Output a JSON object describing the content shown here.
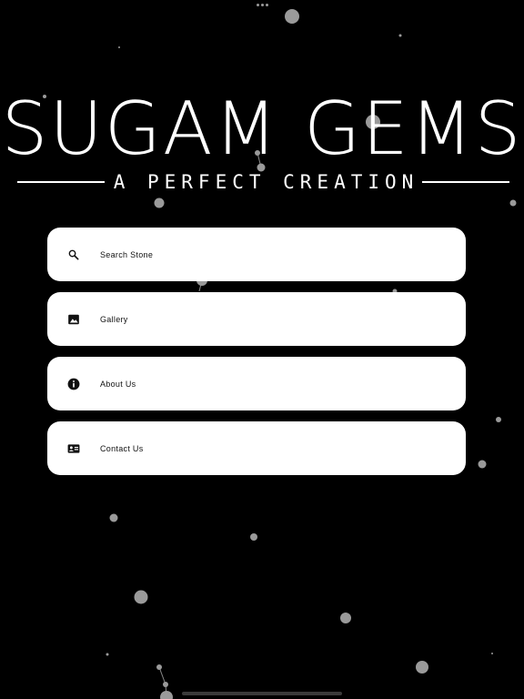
{
  "brand": {
    "title": "SUGAM GEMS",
    "tagline": "A PERFECT CREATION"
  },
  "menu": {
    "items": [
      {
        "label": "Search Stone",
        "icon": "search-icon"
      },
      {
        "label": "Gallery",
        "icon": "image-icon"
      },
      {
        "label": "About Us",
        "icon": "info-icon"
      },
      {
        "label": "Contact Us",
        "icon": "contact-card-icon"
      }
    ]
  },
  "colors": {
    "background": "#000000",
    "card": "#ffffff",
    "particle": "#9a9a9a"
  }
}
